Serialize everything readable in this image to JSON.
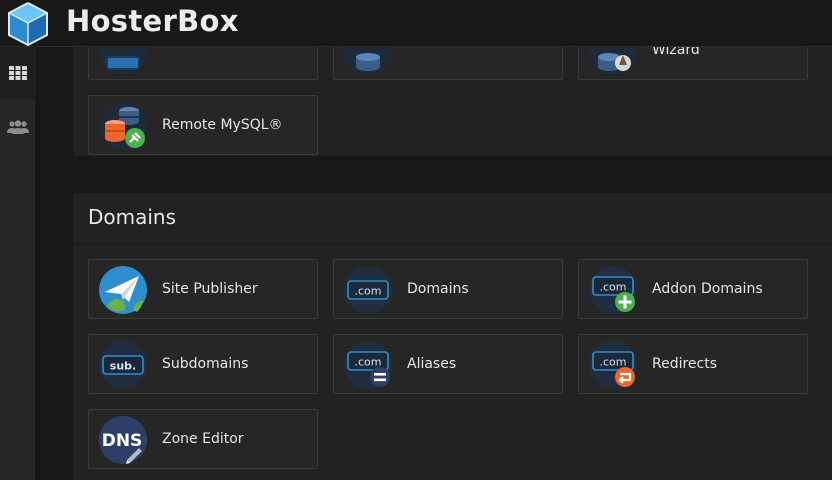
{
  "app": {
    "brand": "HosterBox"
  },
  "sidebar": {
    "items": [
      {
        "icon": "grid-icon"
      },
      {
        "icon": "users-icon"
      }
    ]
  },
  "databases_section": {
    "tiles": [
      {
        "label": ""
      },
      {
        "label": ""
      },
      {
        "label": "Wizard"
      },
      {
        "label": "Remote MySQL®"
      }
    ]
  },
  "domains_section": {
    "title": "Domains",
    "tiles": [
      {
        "label": "Site Publisher",
        "icon": "site-publisher-icon"
      },
      {
        "label": "Domains",
        "icon": "domains-icon",
        "badge": ".com"
      },
      {
        "label": "Addon Domains",
        "icon": "addon-domains-icon",
        "badge": ".com"
      },
      {
        "label": "Subdomains",
        "icon": "subdomains-icon",
        "badge": "sub."
      },
      {
        "label": "Aliases",
        "icon": "aliases-icon",
        "badge": ".com"
      },
      {
        "label": "Redirects",
        "icon": "redirects-icon",
        "badge": ".com"
      },
      {
        "label": "Zone Editor",
        "icon": "zone-editor-icon",
        "badge": "DNS"
      }
    ]
  },
  "colors": {
    "accent_blue": "#2f8fce",
    "green": "#4caf50",
    "orange": "#f0642d",
    "navy": "#2e3f67"
  }
}
